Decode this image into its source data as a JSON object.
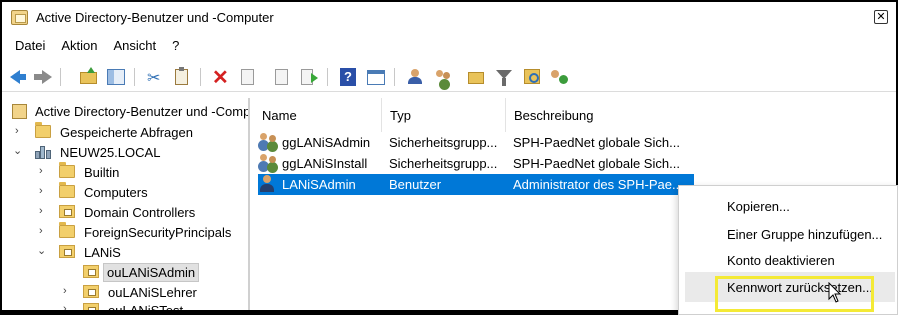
{
  "window": {
    "title": "Active Directory-Benutzer und -Computer",
    "close_glyph": "✕"
  },
  "menubar": {
    "items": [
      "Datei",
      "Aktion",
      "Ansicht",
      "?"
    ]
  },
  "toolbar": {
    "icons": [
      "back-arrow-icon",
      "forward-arrow-icon",
      "up-one-level-icon",
      "show-console-tree-icon",
      "cut-icon",
      "paste-icon",
      "delete-icon",
      "properties-doc-icon",
      "refresh-icon",
      "export-list-icon",
      "help-icon",
      "action-pane-icon",
      "new-user-icon",
      "new-group-icon",
      "new-ou-icon",
      "filter-icon",
      "find-icon",
      "delegate-control-icon"
    ]
  },
  "tree": {
    "root": "Active Directory-Benutzer und -Comp",
    "items": [
      {
        "label": "Gespeicherte Abfragen",
        "icon": "folder-icon",
        "expander": "›"
      },
      {
        "label": "NEUW25.LOCAL",
        "icon": "domain-icon",
        "expander": "⌄"
      },
      {
        "label": "Builtin",
        "icon": "folder-icon",
        "expander": "›"
      },
      {
        "label": "Computers",
        "icon": "folder-icon",
        "expander": "›"
      },
      {
        "label": "Domain Controllers",
        "icon": "ou-icon",
        "expander": "›"
      },
      {
        "label": "ForeignSecurityPrincipals",
        "icon": "folder-icon",
        "expander": "›"
      },
      {
        "label": "LANiS",
        "icon": "ou-icon",
        "expander": "⌄"
      },
      {
        "label": "ouLANiSAdmin",
        "icon": "ou-icon",
        "expander": ""
      },
      {
        "label": "ouLANiSLehrer",
        "icon": "ou-icon",
        "expander": "›"
      },
      {
        "label": "ouLANiSTest",
        "icon": "ou-icon",
        "expander": "›"
      }
    ]
  },
  "list": {
    "columns": [
      "Name",
      "Typ",
      "Beschreibung"
    ],
    "rows": [
      {
        "name": "ggLANiSAdmin",
        "type": "Sicherheitsgrupp...",
        "description": "SPH-PaedNet globale Sich...",
        "icon": "group-icon"
      },
      {
        "name": "ggLANiSInstall",
        "type": "Sicherheitsgrupp...",
        "description": "SPH-PaedNet globale Sich...",
        "icon": "group-icon"
      },
      {
        "name": "LANiSAdmin",
        "type": "Benutzer",
        "description": "Administrator des SPH-Pae...",
        "icon": "user-icon"
      }
    ]
  },
  "context_menu": {
    "items": [
      "Kopieren...",
      "Einer Gruppe hinzufügen...",
      "Konto deaktivieren",
      "Kennwort zurücksetzen..."
    ]
  },
  "colors": {
    "selection": "#0078d7",
    "highlight_box": "#f4ea36"
  }
}
